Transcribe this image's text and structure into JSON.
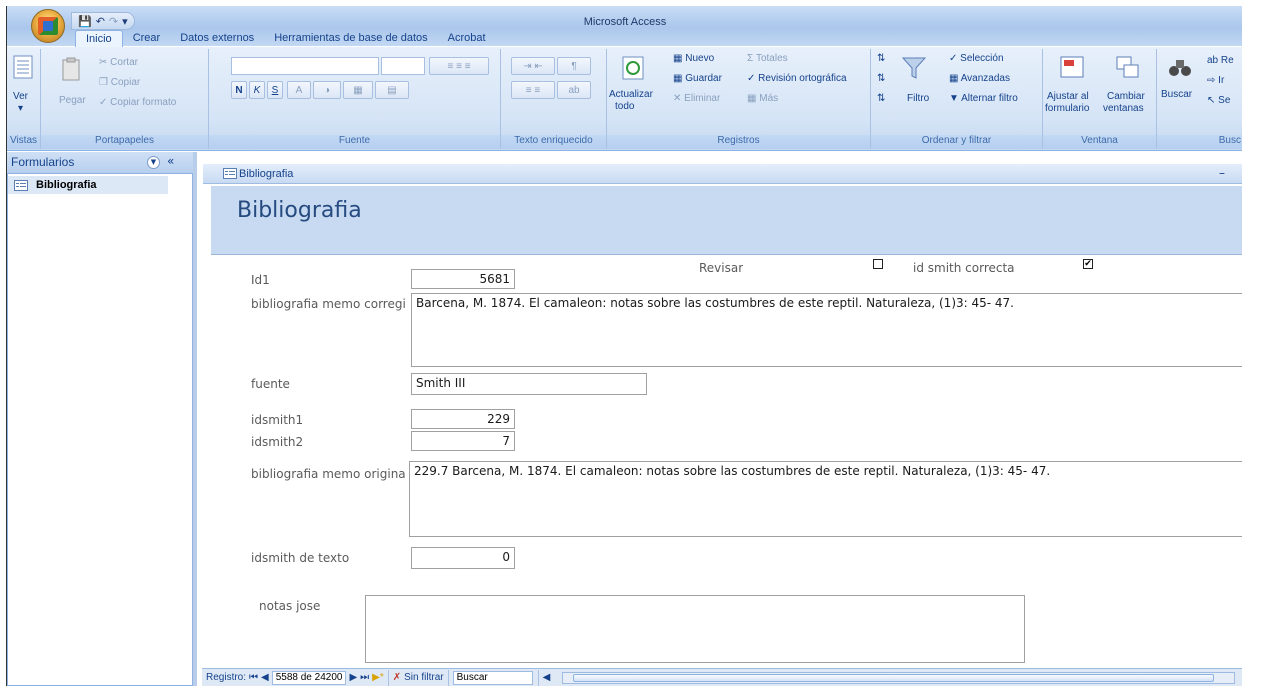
{
  "app": {
    "title": "Microsoft Access",
    "tabs": [
      "Inicio",
      "Crear",
      "Datos externos",
      "Herramientas de base de datos",
      "Acrobat"
    ]
  },
  "ribbon": {
    "vistas": {
      "label": "Vistas",
      "ver": "Ver"
    },
    "portapapeles": {
      "label": "Portapapeles",
      "pegar": "Pegar",
      "cortar": "Cortar",
      "copiar": "Copiar",
      "copiar_formato": "Copiar formato"
    },
    "fuente": {
      "label": "Fuente",
      "bold": "N",
      "italic": "K",
      "underline": "S",
      "font_color": "A"
    },
    "texto": {
      "label": "Texto enriquecido"
    },
    "registros": {
      "label": "Registros",
      "actualizar": "Actualizar",
      "todo": "todo",
      "nuevo": "Nuevo",
      "guardar": "Guardar",
      "eliminar": "Eliminar",
      "totales": "Totales",
      "revision": "Revisión ortográfica",
      "mas": "Más"
    },
    "ordenar": {
      "label": "Ordenar y filtrar",
      "filtro": "Filtro",
      "seleccion": "Selección",
      "avanzadas": "Avanzadas",
      "alternar": "Alternar filtro"
    },
    "ventana": {
      "label": "Ventana",
      "ajustar": "Ajustar al",
      "formulario": "formulario",
      "cambiar": "Cambiar",
      "ventanas": "ventanas"
    },
    "buscar": {
      "label": "Busc",
      "buscar": "Buscar",
      "reemplazar": "Re",
      "ir": "Ir",
      "seleccionar": "Se"
    }
  },
  "nav": {
    "header": "Formularios",
    "items": [
      {
        "label": "Bibliografia"
      }
    ]
  },
  "form": {
    "tab_title": "Bibliografia",
    "header_title": "Bibliografia",
    "fields": {
      "id1_label": "Id1",
      "id1_value": "5681",
      "revisar_label": "Revisar",
      "idsmith_correcta_label": "id smith correcta",
      "bib_corregi_label": "bibliografia memo corregi",
      "bib_corregi_value": "Barcena, M. 1874. El camaleon: notas sobre las costumbres de este reptil. Naturaleza, (1)3: 45- 47.",
      "fuente_label": "fuente",
      "fuente_value": "Smith III",
      "idsmith1_label": "idsmith1",
      "idsmith1_value": "229",
      "idsmith2_label": "idsmith2",
      "idsmith2_value": "7",
      "bib_origina_label": "bibliografia  memo origina",
      "bib_origina_value": "229.7 Barcena, M. 1874. El camaleon: notas sobre las costumbres de este reptil. Naturaleza, (1)3: 45- 47.",
      "idsmith_texto_label": "idsmith de texto",
      "idsmith_texto_value": "0",
      "notas_label": "notas jose",
      "notas_value": ""
    },
    "checkboxes": {
      "revisar": false,
      "idsmith_correcta": true
    }
  },
  "recnav": {
    "registro_label": "Registro:",
    "position": "5588 de 24200",
    "filter": "Sin filtrar",
    "search": "Buscar"
  }
}
